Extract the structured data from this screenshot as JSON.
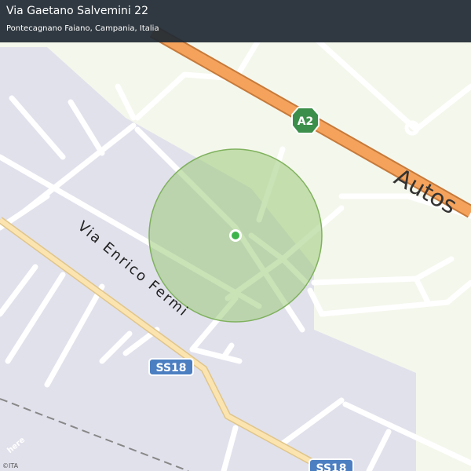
{
  "header": {
    "address": "Via Gaetano Salvemini 22",
    "locality": "Pontecagnano Faiano, Campania, Italia"
  },
  "map": {
    "labels": {
      "motorway_name": "Autos",
      "motorway_shield": "A2",
      "street_name": "Via Enrico Fermi",
      "route_shield_1": "SS18",
      "route_shield_2": "SS18"
    },
    "logo": "here",
    "copyright": "©ITA",
    "colors": {
      "background": "#f4f7ec",
      "industrial_area": "#e1e1ec",
      "motorway": "#f5a35c",
      "primary_road": "#fbe4b0",
      "accuracy_circle": "#9ccb7a",
      "location_dot": "#3cb44b",
      "shield_motorway": "#3c8f4a",
      "shield_route": "#4c7fc2"
    },
    "icons": [
      "location-dot-icon",
      "motorway-shield-icon",
      "route-shield-icon"
    ]
  }
}
